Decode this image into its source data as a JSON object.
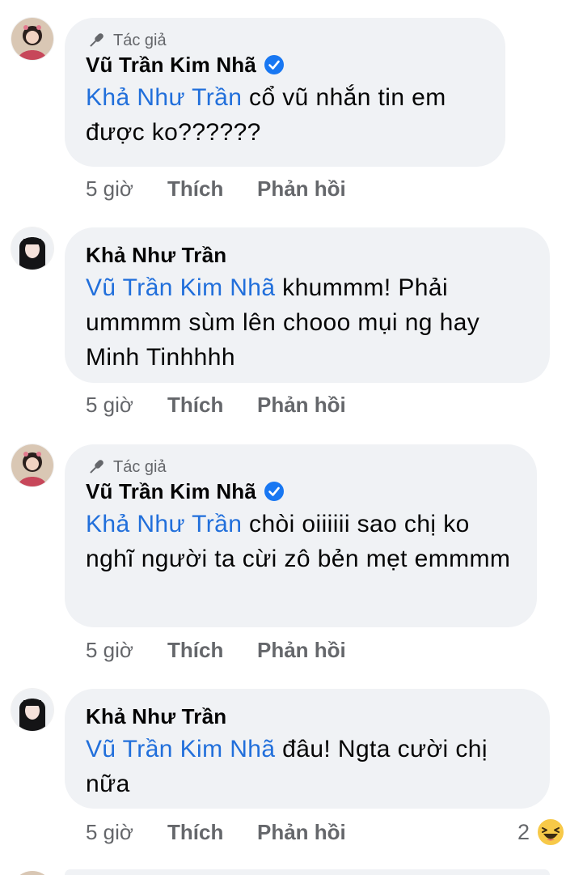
{
  "comments": [
    {
      "badge": "Tác giả",
      "author": "Vũ Trần Kim Nhã",
      "mention": "Khả Như Trần",
      "text": " cổ vũ nhắn tin em được ko??????",
      "time": "5 giờ",
      "like": "Thích",
      "reply": "Phản hồi"
    },
    {
      "author": "Khả Như Trần",
      "mention": "Vũ Trần Kim Nhã",
      "text": " khummm! Phải ummmm sùm lên chooo mụi ng hay Minh Tinhhhh",
      "time": "5 giờ",
      "like": "Thích",
      "reply": "Phản hồi"
    },
    {
      "badge": "Tác giả",
      "author": "Vũ Trần Kim Nhã",
      "mention": "Khả Như Trần",
      "text": " chòi oiiiiii sao chị ko nghĩ người ta cừi zô bẻn mẹt emmmm",
      "time": "5 giờ",
      "like": "Thích",
      "reply": "Phản hồi"
    },
    {
      "author": "Khả Như Trần",
      "mention": "Vũ Trần Kim Nhã",
      "text": " đâu! Ngta cười chị nữa",
      "time": "5 giờ",
      "like": "Thích",
      "reply": "Phản hồi",
      "reaction_count": "2",
      "reaction_icon": "haha-emoji-icon"
    }
  ],
  "colors": {
    "bubble": "#f0f2f5",
    "mention": "#216fdb",
    "verified": "#1877f2",
    "meta": "#65676b"
  }
}
